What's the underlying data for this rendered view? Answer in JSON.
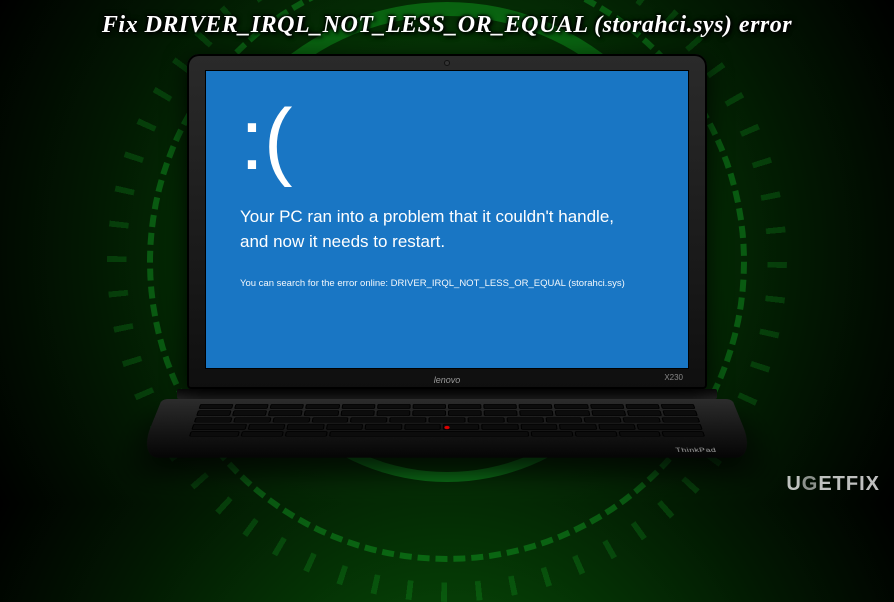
{
  "title": "Fix DRIVER_IRQL_NOT_LESS_OR_EQUAL (storahci.sys) error",
  "bsod": {
    "face": ":(",
    "message": "Your PC ran into a problem that it couldn't handle, and now it needs to restart.",
    "detail": "You can search for the error online: DRIVER_IRQL_NOT_LESS_OR_EQUAL (storahci.sys)"
  },
  "laptop": {
    "brand": "lenovo",
    "model": "X230",
    "series": "ThinkPad"
  },
  "watermark": {
    "prefix": "U",
    "mid": "G",
    "suffix": "ETFIX"
  }
}
